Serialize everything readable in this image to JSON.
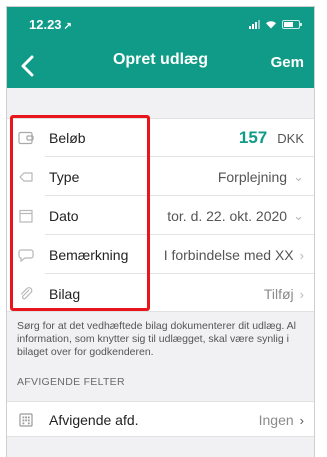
{
  "status_bar": {
    "time": "12.23",
    "location_arrow": "↗"
  },
  "header": {
    "title": "Opret udlæg",
    "save_label": "Gem",
    "back_icon": "chevron-left-icon",
    "background": "#0f9b87"
  },
  "fields": [
    {
      "label": "Beløb",
      "value": "157",
      "unit": "DKK",
      "icon": "wallet-icon"
    },
    {
      "label": "Type",
      "value": "Forplejning",
      "icon": "tag-icon",
      "chevron": "⌄"
    },
    {
      "label": "Dato",
      "value": "tor. d. 22. okt. 2020",
      "icon": "calendar-icon",
      "chevron": "⌄"
    },
    {
      "label": "Bemærkning",
      "value": "I forbindelse med XX",
      "icon": "comment-icon",
      "chevron": "›"
    },
    {
      "label": "Bilag",
      "value": "Tilføj",
      "icon": "paperclip-icon",
      "chevron": "›"
    }
  ],
  "info_text": "Sørg for at det vedhæftede bilag dokumenterer dit udlæg. Al information, som knytter sig til udlægget, skal være synlig i bilaget over for godkenderen.",
  "section_title": "AFVIGENDE FELTER",
  "deviating": {
    "label": "Afvigende afd.",
    "value": "Ingen",
    "chevron": "›",
    "icon": "building-icon"
  },
  "colors": {
    "accent": "#0f9b87",
    "highlight": "#e8161c"
  }
}
